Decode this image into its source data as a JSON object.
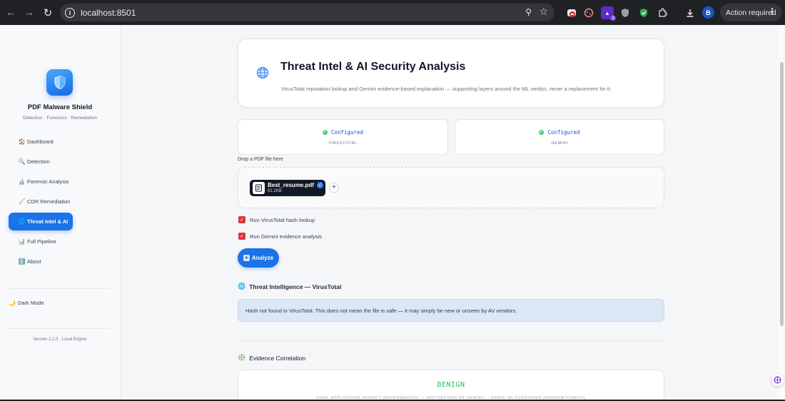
{
  "browser": {
    "url": "localhost:8501",
    "avatar_letter": "B",
    "action_label": "Action required",
    "extension_badge": "3"
  },
  "sidebar": {
    "brand_title": "PDF Malware Shield",
    "brand_subtitle": "Detection · Forensics · Remediation",
    "items": [
      {
        "icon": "🏠",
        "label": "Dashboard"
      },
      {
        "icon": "🔍",
        "label": "Detection"
      },
      {
        "icon": "🔬",
        "label": "Forensic Analysis"
      },
      {
        "icon": "🧹",
        "label": "CDR Remediation"
      },
      {
        "icon": "🌐",
        "label": "Threat Intel & AI"
      },
      {
        "icon": "📊",
        "label": "Full Pipeline"
      },
      {
        "icon": "ℹ️",
        "label": "About"
      }
    ],
    "active_index": 4,
    "dark_mode": {
      "icon": "🌙",
      "label": "Dark Mode"
    },
    "version": "Version 2.1.0 · Local Engine"
  },
  "main": {
    "title": "Threat Intel & AI Security Analysis",
    "description": "VirusTotal reputation lookup and Gemini evidence-based explanation — supporting layers around the ML verdict, never a replacement for it.",
    "status_cards": [
      {
        "status": "Configured",
        "label": "VIRUSTOTAL"
      },
      {
        "status": "Configured",
        "label": "GEMINI"
      }
    ],
    "upload": {
      "label": "Drop a PDF file here",
      "file_name": "Best_resume.pdf",
      "file_size": "61.2KB"
    },
    "checkboxes": [
      {
        "label": "Run VirusTotal hash lookup",
        "checked": true
      },
      {
        "label": "Run Gemini evidence analysis",
        "checked": true
      }
    ],
    "analyze_label": "Analyze",
    "threat_section": {
      "icon": "🌐",
      "title": "Threat Intelligence — VirusTotal",
      "message": "Hash not found in VirusTotal. This does not mean the file is safe — it may simply be new or unseen by AV vendors."
    },
    "evidence_section": {
      "icon": "❇️",
      "title": "Evidence Correlation",
      "verdict": "BENIGN",
      "verdict_sub": "FINAL APPLICATION VERDICT (DETERMINISTIC — NOT DECIDED BY GEMINI) — BASIS: ML CLASSIFIER (RANDOM FOREST)"
    }
  },
  "colors": {
    "accent": "#1a73e8",
    "checkbox": "#e0333a",
    "verdict_benign": "#22c55e",
    "info_bg": "#dbe6f6"
  }
}
